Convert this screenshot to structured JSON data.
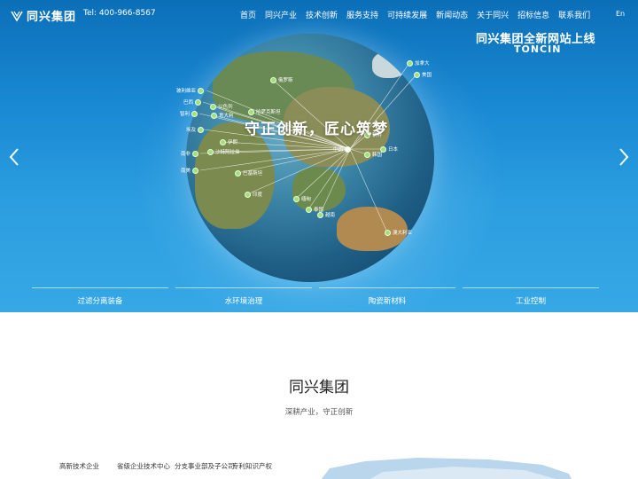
{
  "header": {
    "logo_text": "同兴集团",
    "tel": "Tel:  400-966-8567",
    "nav": [
      "首页",
      "同兴产业",
      "技术创新",
      "服务支持",
      "可持续发展",
      "新闻动态",
      "关于同兴",
      "招标信息",
      "联系我们"
    ],
    "lang": "En"
  },
  "banner": {
    "slogan_cn": "同兴集团全新网站上线",
    "slogan_en": "TONCIN",
    "center_text": "守正创新，匠心筑梦",
    "pins": [
      {
        "name": "加拿大"
      },
      {
        "name": "美国"
      },
      {
        "name": "俄罗斯"
      },
      {
        "name": "玻利维亚"
      },
      {
        "name": "巴西"
      },
      {
        "name": "以色列"
      },
      {
        "name": "智利"
      },
      {
        "name": "意大利"
      },
      {
        "name": "哈萨克斯坦"
      },
      {
        "name": "埃及"
      },
      {
        "name": "伊朗"
      },
      {
        "name": "南非"
      },
      {
        "name": "沙特阿拉伯"
      },
      {
        "name": "南美"
      },
      {
        "name": "巴基斯坦"
      },
      {
        "name": "中国"
      },
      {
        "name": "朝鲜"
      },
      {
        "name": "日本"
      },
      {
        "name": "韩国"
      },
      {
        "name": "印度"
      },
      {
        "name": "缅甸"
      },
      {
        "name": "泰国"
      },
      {
        "name": "越南"
      },
      {
        "name": "澳大利亚"
      }
    ],
    "tabs": [
      "过滤分离装备",
      "水环境治理",
      "陶瓷新材料",
      "工业控制"
    ]
  },
  "intro": {
    "title": "同兴集团",
    "subtitle": "深耕产业，守正创新",
    "stats": [
      "高新技术企业",
      "省级企业技术中心",
      "分支事业部及子公司",
      "专利知识产权"
    ]
  },
  "colors": {
    "accent": "#1a8ad4",
    "pin": "#9ee07a"
  }
}
